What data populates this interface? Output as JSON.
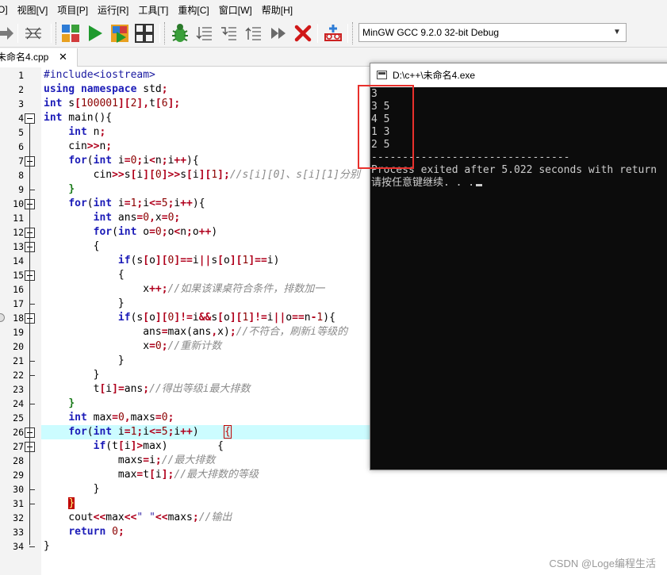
{
  "menu": {
    "items": [
      "O]",
      "视图[V]",
      "项目[P]",
      "运行[R]",
      "工具[T]",
      "重构[C]",
      "窗口[W]",
      "帮助[H]"
    ]
  },
  "toolbar": {
    "icons": [
      "arrow-right-icon",
      "compile-icon",
      "compile-grid-icon",
      "run-icon",
      "compile-run-icon",
      "rebuild-grid-icon",
      "debug-icon",
      "step-icon",
      "step-into-icon",
      "step-over-icon",
      "continue-icon",
      "stop-icon",
      "profile-icon"
    ],
    "compiler_select": "MinGW GCC 9.2.0 32-bit Debug"
  },
  "tab": {
    "label": "未命名4.cpp",
    "close": "✕"
  },
  "line_numbers": [
    "1",
    "2",
    "3",
    "4",
    "5",
    "6",
    "7",
    "8",
    "9",
    "10",
    "11",
    "12",
    "13",
    "14",
    "15",
    "16",
    "17",
    "18",
    "19",
    "20",
    "21",
    "22",
    "23",
    "24",
    "25",
    "26",
    "27",
    "28",
    "29",
    "30",
    "31",
    "32",
    "33",
    "34"
  ],
  "code_lines": [
    "#include<iostream>",
    "using namespace std;",
    "int s[100001][2],t[6];",
    "int main(){",
    "    int n;",
    "    cin>>n;",
    "    for(int i=0;i<n;i++){",
    "        cin>>s[i][0]>>s[i][1];//s[i][0]、s[i][1]分别",
    "    }",
    "    for(int i=1;i<=5;i++){",
    "        int ans=0,x=0;",
    "        for(int o=0;o<n;o++)",
    "        {",
    "            if(s[o][0]==i||s[o][1]==i)",
    "            {",
    "                x++;//如果该课桌符合条件，排数加一",
    "            }",
    "            if(s[o][0]!=i&&s[o][1]!=i||o==n-1){",
    "                ans=max(ans,x);//不符合，刷新i等级的",
    "                x=0;//重新计数",
    "            }",
    "        }",
    "        t[i]=ans;//得出等级i最大排数",
    "    }",
    "    int max=0,maxs=0;",
    "    for(int i=1;i<=5;i++)    {",
    "        if(t[i]>max)        {",
    "            maxs=i;//最大排数",
    "            max=t[i];//最大排数的等级",
    "        }",
    "    }",
    "    cout<<max<<\" \"<<maxs;//输出",
    "    return 0;",
    "}"
  ],
  "console": {
    "title": "D:\\c++\\未命名4.exe",
    "lines": [
      "3",
      "3 5",
      "4 5",
      "1 3",
      "2 5",
      "--------------------------------",
      "Process exited after 5.022 seconds with return",
      "请按任意键继续. . ."
    ]
  },
  "watermark": "CSDN @Loge编程生活",
  "colors": {
    "keyword": "#1c1cb8",
    "number": "#8b0000",
    "comment": "#8a8a8a",
    "highlight": "#ccfcff",
    "annotation": "#e8302c"
  }
}
